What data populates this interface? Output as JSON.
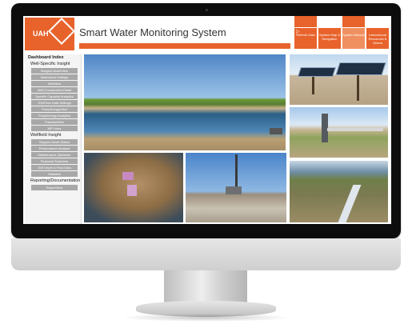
{
  "header": {
    "logo_text": "UAH",
    "title": "Smart Water Monitoring System",
    "nav": [
      {
        "label": "Refresh Data",
        "icon": "play-icon"
      },
      {
        "label": "System Map & Navigation"
      },
      {
        "label": "System Manual"
      },
      {
        "label": "Instructional Resources & Videos"
      }
    ]
  },
  "sidebar": {
    "heading": "Dashboard Index",
    "sections": [
      {
        "title": "Well-Specific Insight",
        "items": [
          "Mapped AssetView",
          "Watershed Settings",
          "WellView",
          "Well Construction Detail",
          "Specific Capacity Analytics",
          "GW/Flow Data Settings",
          "PumpEnergyView",
          "PumpEnergy Analytics",
          "PotentialView",
          "MPI View"
        ]
      },
      {
        "title": "Wellfield Insight",
        "items": [
          "Mapped Asset Status",
          "Performance Analysis",
          "Maintenance Optimizer",
          "Financial Summary",
          "GW Depth & Flow Data",
          "Statistics"
        ]
      },
      {
        "title": "Reporting/Documentation",
        "items": [
          "ReportView"
        ]
      }
    ]
  },
  "colors": {
    "accent": "#e8632b",
    "sidebar_button": "#a8a8a8",
    "bezel": "#0d0d0e"
  }
}
